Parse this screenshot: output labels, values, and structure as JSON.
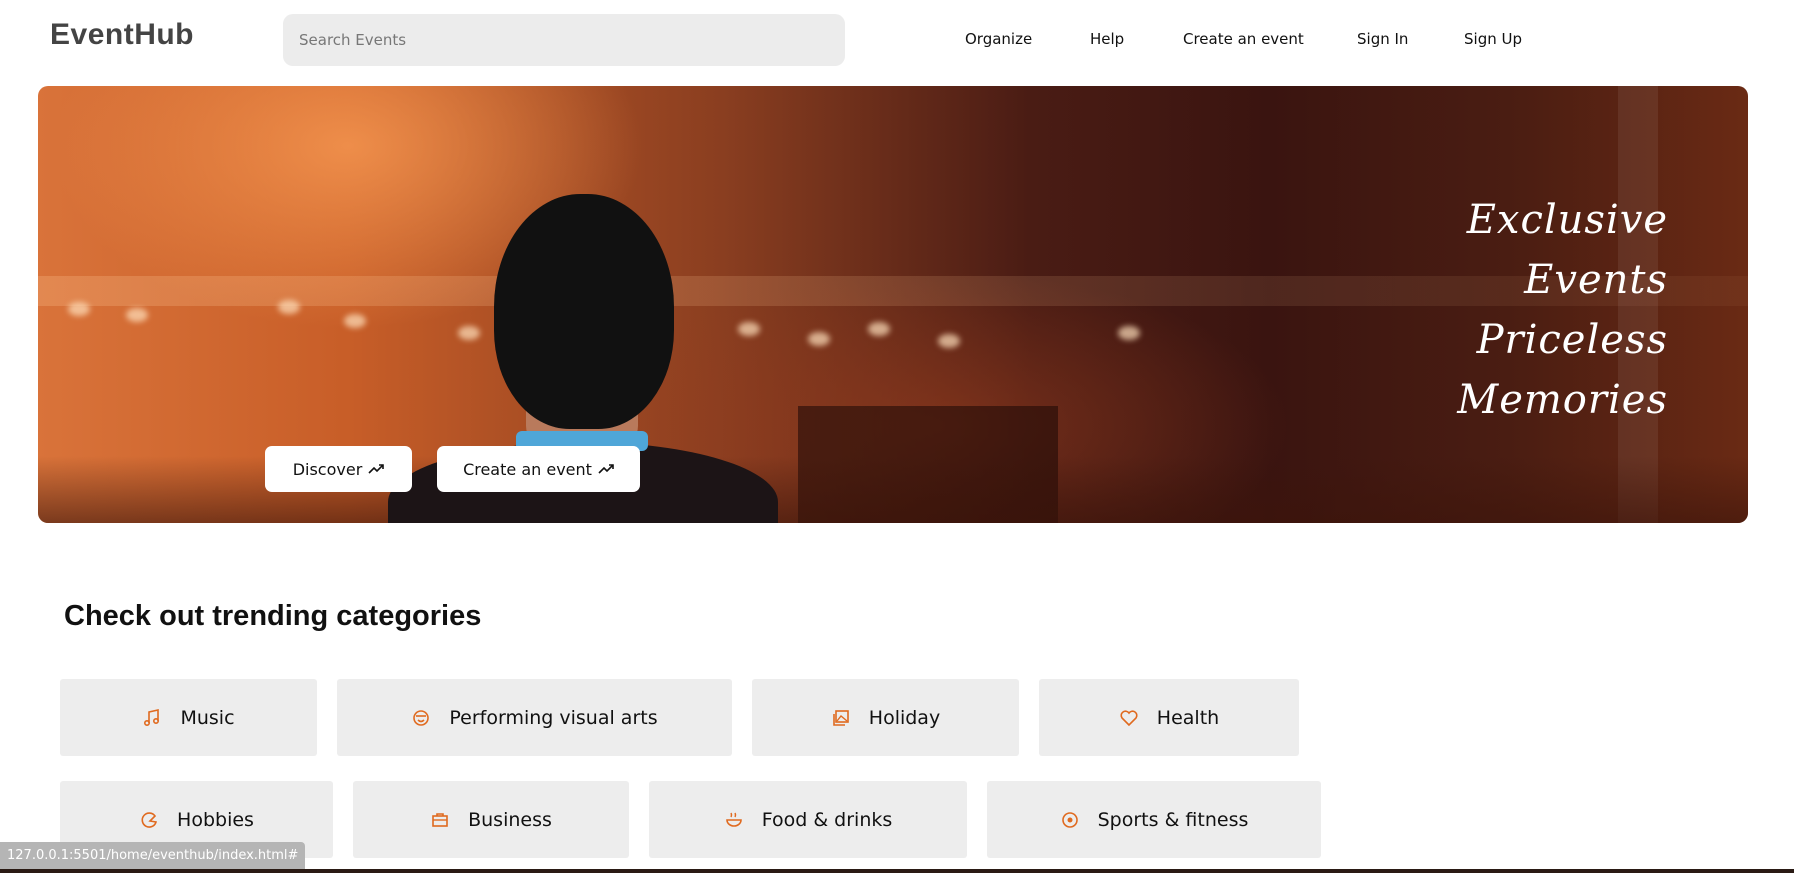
{
  "header": {
    "logo": "EventHub",
    "search_placeholder": "Search Events",
    "nav": [
      "Organize",
      "Help",
      "Create an event",
      "Sign In",
      "Sign Up"
    ]
  },
  "hero": {
    "buttons": [
      "Discover",
      "Create an event"
    ],
    "tagline": [
      "Exclusive",
      "Events",
      "Priceless",
      "Memories"
    ]
  },
  "categories": {
    "title": "Check out trending categories",
    "items": [
      {
        "label": "Music",
        "icon": "music-note-icon"
      },
      {
        "label": "Performing visual arts",
        "icon": "mask-icon"
      },
      {
        "label": "Holiday",
        "icon": "photo-gallery-icon"
      },
      {
        "label": "Health",
        "icon": "heart-icon"
      },
      {
        "label": "Hobbies",
        "icon": "palette-icon"
      },
      {
        "label": "Business",
        "icon": "briefcase-icon"
      },
      {
        "label": "Food & drinks",
        "icon": "bowl-icon"
      },
      {
        "label": "Sports & fitness",
        "icon": "ball-icon"
      }
    ]
  },
  "status_bar": {
    "url": "127.0.0.1:5501/home/eventhub/index.html#"
  },
  "colors": {
    "accent": "#e06a1f",
    "card_bg": "#ededed"
  }
}
